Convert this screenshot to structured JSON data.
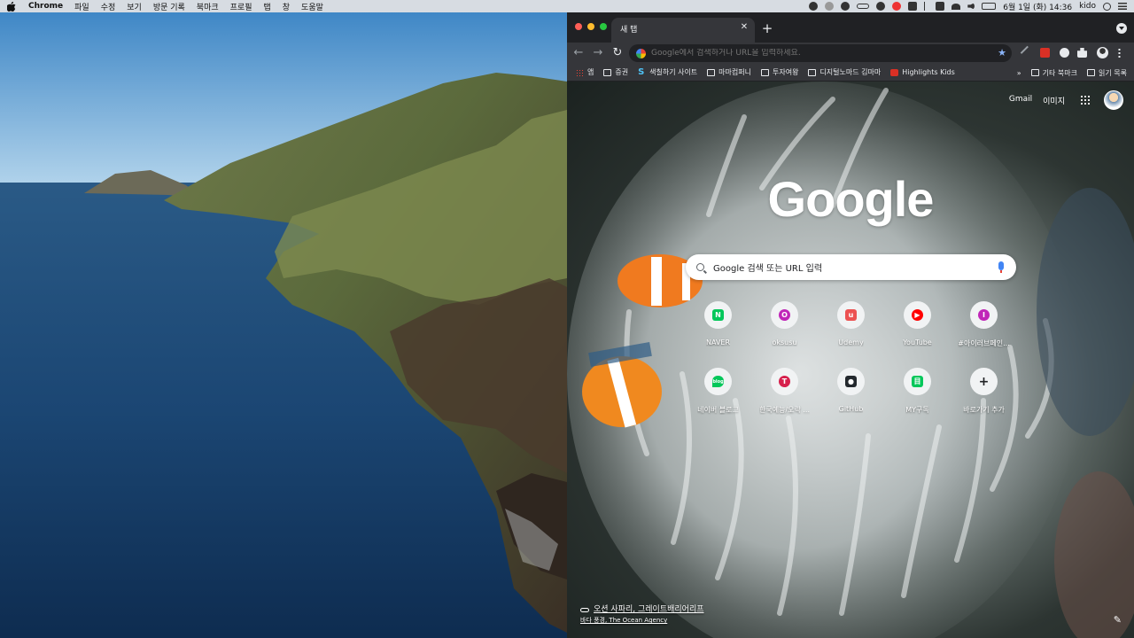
{
  "menubar": {
    "app_name": "Chrome",
    "items": [
      "파일",
      "수정",
      "보기",
      "방문 기록",
      "북마크",
      "프로필",
      "탭",
      "창",
      "도움말"
    ],
    "datetime": "6월 1일 (화) 14:36",
    "user": "kido"
  },
  "tab": {
    "title": "새 탭"
  },
  "omnibox": {
    "placeholder": "Google에서 검색하거나 URL을 입력하세요."
  },
  "bookmarks": {
    "items": [
      "앱",
      "증권",
      "색칠하기 사이트",
      "마마컴퍼니",
      "투자여왕",
      "디지털노마드 김마마",
      "Highlights Kids"
    ],
    "more": "»",
    "other": "기타 북마크",
    "reading_list": "읽기 목록"
  },
  "ntp": {
    "links": {
      "gmail": "Gmail",
      "images": "이미지"
    },
    "logo": "Google",
    "search_placeholder": "Google 검색 또는 URL 입력",
    "shortcuts": [
      {
        "label": "NAVER",
        "glyph": "N",
        "color": "#03c75a",
        "icon": "naver-icon"
      },
      {
        "label": "oksusu",
        "glyph": "O",
        "color": "#c026b8",
        "icon": "oksusu-icon"
      },
      {
        "label": "Udemy",
        "glyph": "u",
        "color": "#ec5252",
        "icon": "udemy-icon"
      },
      {
        "label": "YouTube",
        "glyph": "▶",
        "color": "#ff0000",
        "icon": "youtube-icon"
      },
      {
        "label": "#아이러브페인...",
        "glyph": "I",
        "color": "#c026b8",
        "icon": "site-i-icon"
      },
      {
        "label": "네이버 블로그",
        "glyph": "blog",
        "color": "#03c75a",
        "icon": "naver-blog-icon"
      },
      {
        "label": "한국예능/오락 ...",
        "glyph": "T",
        "color": "#d6204c",
        "icon": "site-t-icon"
      },
      {
        "label": "GitHub",
        "glyph": "●",
        "color": "#24292e",
        "icon": "github-icon"
      },
      {
        "label": "MY구독",
        "glyph": "目",
        "color": "#03c75a",
        "icon": "my-subscription-icon"
      },
      {
        "label": "바로가기 추가",
        "glyph": "+",
        "color": "#f1f3f4",
        "icon": "add-shortcut-icon"
      }
    ],
    "attribution": {
      "title": "오션 사파리, 그레이트배리어리프",
      "credit": "바다 풍경, The Ocean Agency"
    }
  }
}
